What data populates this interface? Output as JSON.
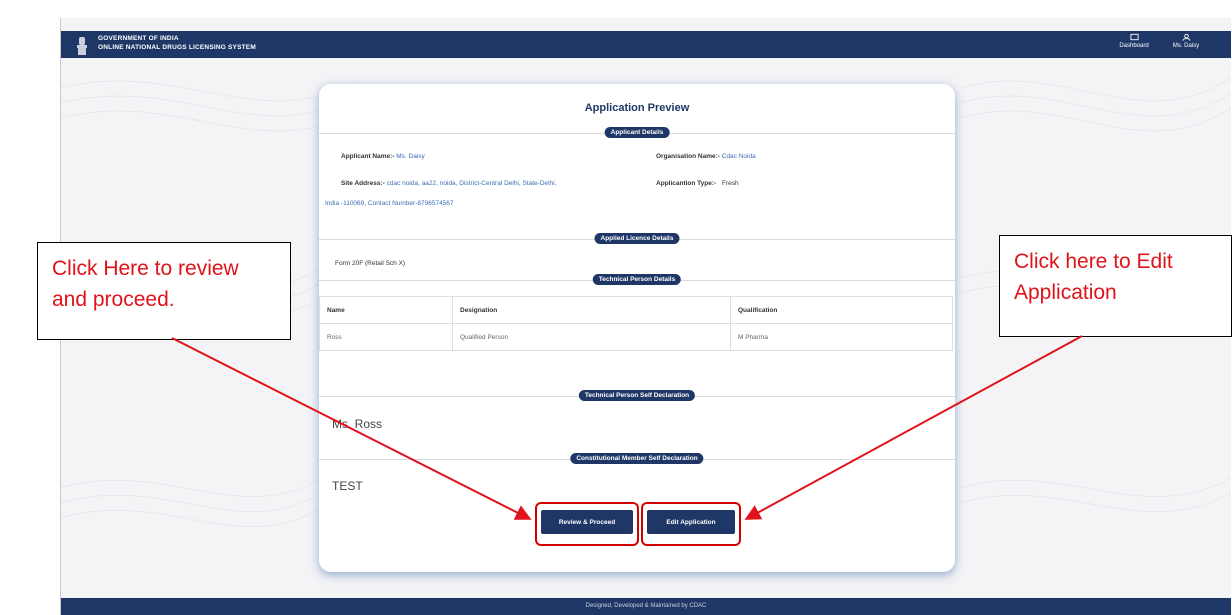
{
  "header": {
    "line1": "GOVERNMENT OF INDIA",
    "line2": "ONLINE NATIONAL DRUGS LICENSING SYSTEM",
    "dashboard_label": "Dashboard",
    "user_label": "Ms. Daisy"
  },
  "card": {
    "title": "Application Preview",
    "applicant_section": "Applicant Details",
    "applicant_name_label": "Applicant Name:-",
    "applicant_name_value": "Ms. Daisy",
    "org_name_label": "Organisation Name:-",
    "org_name_value": "Cdac Noida",
    "site_address_label": "Site Address:-",
    "site_address_value_1": "cdac noida, aa22, noida, District-Central Delhi, State-Delhi,",
    "site_address_value_2": "India -110069, Contact Number-8796574567",
    "app_type_label": "Applicantion Type:-",
    "app_type_value": "Fresh",
    "licence_section": "Applied Licence Details",
    "licence_value": "Form 20F (Retail Sch X)",
    "tech_section": "Technical Person Details",
    "table_headers": [
      "Name",
      "Designation",
      "Qualification"
    ],
    "table_rows": [
      [
        "Ross",
        "Qualified Person",
        "M Pharma"
      ]
    ],
    "tech_decl_section": "Technical Person Self Declaration",
    "tech_decl_value": "Ms. Ross",
    "const_decl_section": "Constitutional Member Self Declaration",
    "const_decl_value": "TEST",
    "review_button": "Review & Proceed",
    "edit_button": "Edit Application"
  },
  "footer": "Designed, Developed & Maintained by CDAC",
  "annotations": {
    "left_callout_1": "Click Here to review",
    "left_callout_2": "and proceed.",
    "right_callout_1": "Click here to Edit",
    "right_callout_2": "Application"
  },
  "colors": {
    "navy": "#1f3766",
    "annotation_red": "#e0131a"
  }
}
